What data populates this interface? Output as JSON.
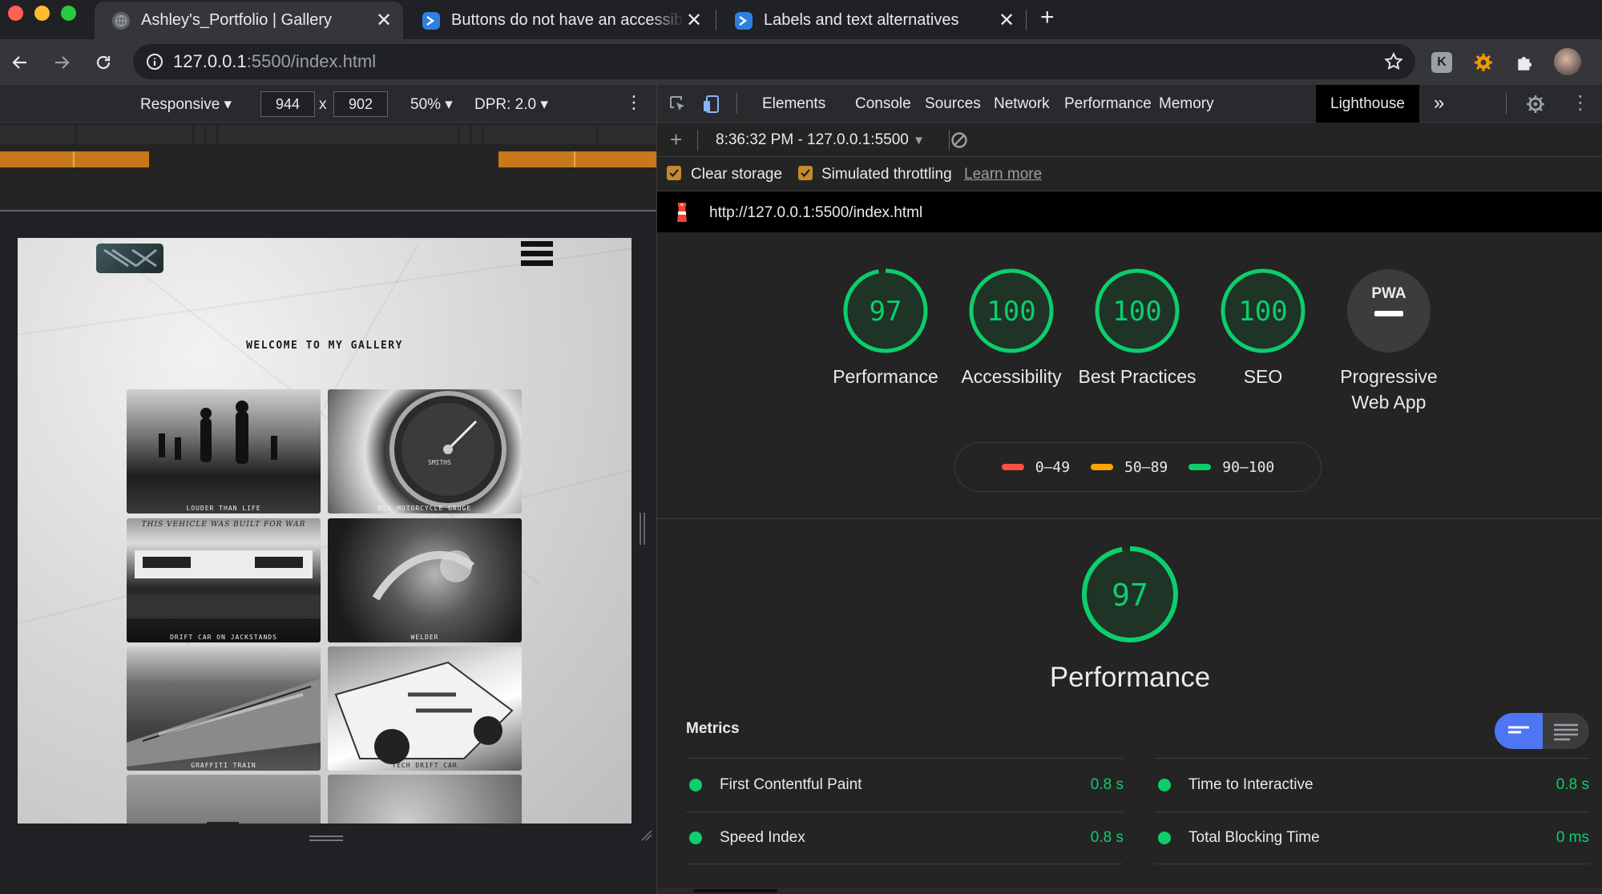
{
  "browser": {
    "tabs": [
      {
        "title": "Ashley's_Portfolio | Gallery",
        "active": true,
        "icon": "globe-icon"
      },
      {
        "title": "Buttons do not have an accessible name",
        "active": false,
        "icon": "powershell-icon"
      },
      {
        "title": "Labels and text alternatives",
        "active": false,
        "icon": "powershell-icon"
      }
    ],
    "new_tab_label": "+",
    "address": {
      "host": "127.0.0.1",
      "path": ":5500/index.html"
    }
  },
  "device_toolbar": {
    "mode": "Responsive",
    "width": "944",
    "times": "x",
    "height": "902",
    "zoom": "50%",
    "dpr": "DPR: 2.0"
  },
  "emulated_page": {
    "heading": "WELCOME TO MY GALLERY",
    "captions": [
      "LOUDER THAN LIFE",
      "BSA MOTORCYCLE GAUGE",
      "DRIFT CAR ON JACKSTANDS",
      "WELDER",
      "GRAFFITI TRAIN",
      "TECH DRIFT CAR"
    ],
    "photo_text": {
      "car_banner": "THIS VEHICLE WAS BUILT FOR WAR",
      "gauge_brand": "SMITHS"
    }
  },
  "devtools": {
    "tabs": [
      "Elements",
      "Console",
      "Sources",
      "Network",
      "Performance",
      "Memory",
      "Lighthouse"
    ],
    "selected_tab": "Lighthouse",
    "more_label": "»",
    "report_selector": "8:36:32 PM - 127.0.0.1:5500",
    "options": {
      "clear_storage": "Clear storage",
      "throttling": "Simulated throttling",
      "learn_more": "Learn more"
    },
    "report_url": "http://127.0.0.1:5500/index.html"
  },
  "lighthouse": {
    "scores": [
      {
        "value": "97",
        "label": "Performance"
      },
      {
        "value": "100",
        "label": "Accessibility"
      },
      {
        "value": "100",
        "label": "Best Practices"
      },
      {
        "value": "100",
        "label": "SEO"
      }
    ],
    "pwa": {
      "badge": "PWA",
      "label": "Progressive Web App"
    },
    "legend": [
      "0–49",
      "50–89",
      "90–100"
    ],
    "legend_colors": [
      "#ff4e42",
      "#ffa400",
      "#0cce6b"
    ],
    "main_score": "97",
    "main_label": "Performance",
    "metrics_title": "Metrics",
    "metrics": [
      {
        "name": "First Contentful Paint",
        "value": "0.8 s"
      },
      {
        "name": "Time to Interactive",
        "value": "0.8 s"
      },
      {
        "name": "Speed Index",
        "value": "0.8 s"
      },
      {
        "name": "Total Blocking Time",
        "value": "0 ms"
      }
    ]
  },
  "colors": {
    "pass": "#0cce6b",
    "accent_blue": "#4e75f3",
    "checkbox": "#c48a2c"
  }
}
